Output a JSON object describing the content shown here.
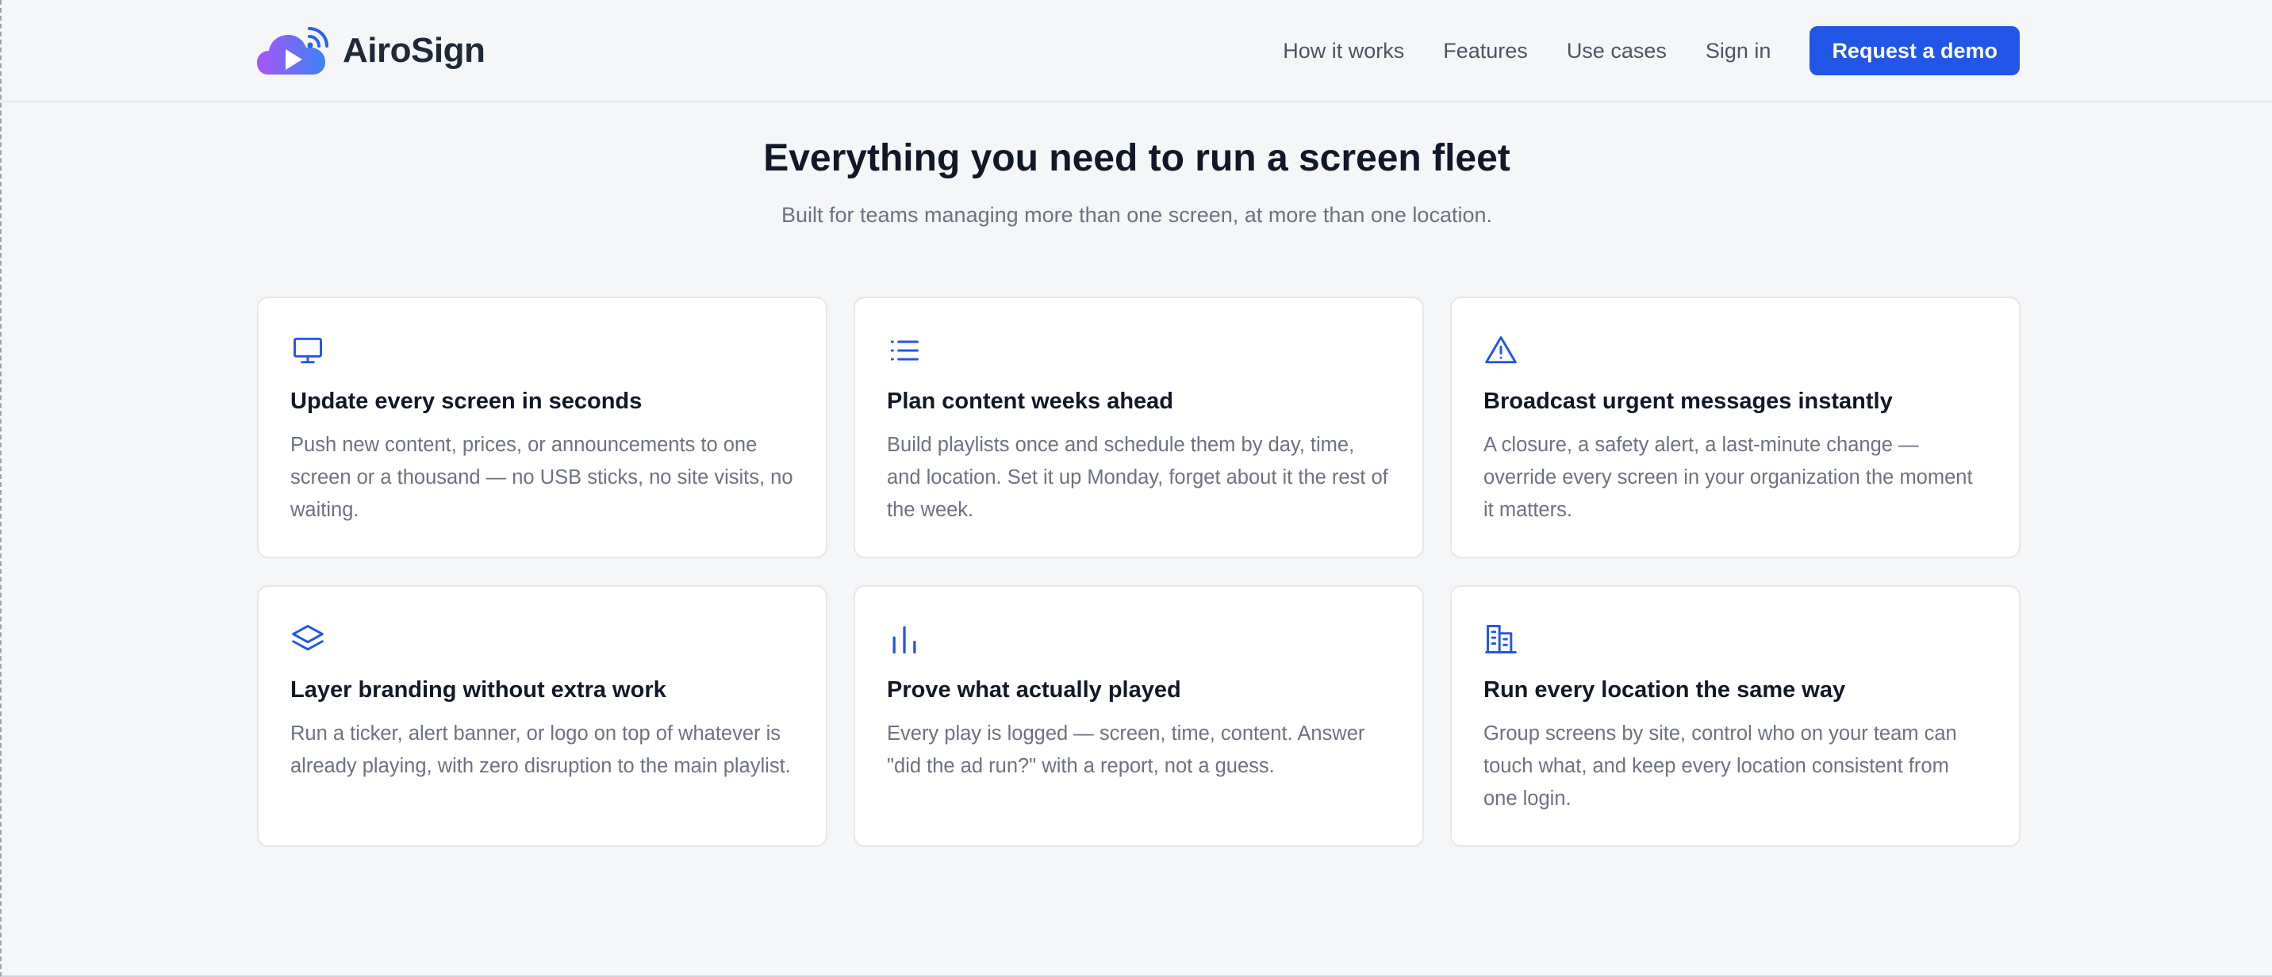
{
  "header": {
    "logo_text": "AiroSign",
    "nav": [
      "How it works",
      "Features",
      "Use cases",
      "Sign in"
    ],
    "cta_label": "Request a demo"
  },
  "section": {
    "title": "Everything you need to run a screen fleet",
    "subtitle": "Built for teams managing more than one screen, at more than one location."
  },
  "features": [
    {
      "icon": "monitor-icon",
      "title": "Update every screen in seconds",
      "text": "Push new content, prices, or announcements to one screen or a thousand — no USB sticks, no site visits, no waiting."
    },
    {
      "icon": "list-icon",
      "title": "Plan content weeks ahead",
      "text": "Build playlists once and schedule them by day, time, and location. Set it up Monday, forget about it the rest of the week."
    },
    {
      "icon": "warning-icon",
      "title": "Broadcast urgent messages instantly",
      "text": "A closure, a safety alert, a last-minute change — override every screen in your organization the moment it matters."
    },
    {
      "icon": "layers-icon",
      "title": "Layer branding without extra work",
      "text": "Run a ticker, alert banner, or logo on top of whatever is already playing, with zero disruption to the main playlist."
    },
    {
      "icon": "bar-chart-icon",
      "title": "Prove what actually played",
      "text": "Every play is logged — screen, time, content. Answer \"did the ad run?\" with a report, not a guess."
    },
    {
      "icon": "building-icon",
      "title": "Run every location the same way",
      "text": "Group screens by site, control who on your team can touch what, and keep every location consistent from one login."
    }
  ],
  "colors": {
    "accent": "#2256e6",
    "background": "#f5f6f8",
    "logo_gradient_start": "#a855f7",
    "logo_gradient_end": "#3b82f6"
  }
}
